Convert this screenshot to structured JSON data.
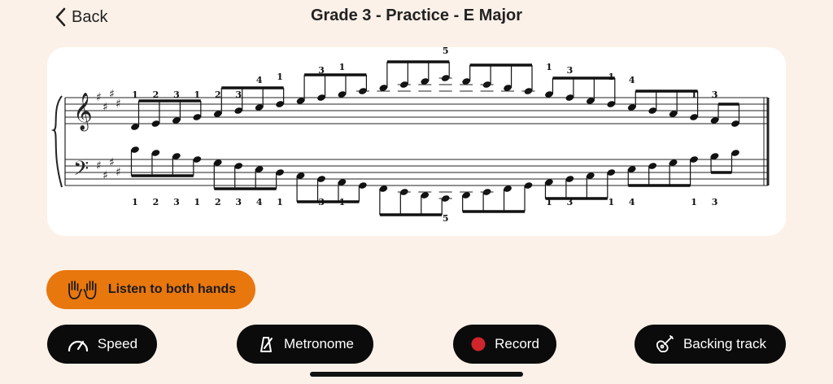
{
  "header": {
    "back_label": "Back",
    "title": "Grade 3 - Practice - E Major"
  },
  "score": {
    "clefs": [
      "treble",
      "bass"
    ],
    "key_signature": "E major (4 sharps)",
    "treble_fingering": [
      "1",
      "2",
      "3",
      "1",
      "2",
      "3",
      "4",
      "1",
      "3",
      "1",
      "5",
      "1",
      "3",
      "1",
      "4",
      "1",
      "3"
    ],
    "bass_fingering": [
      "1",
      "2",
      "3",
      "1",
      "2",
      "3",
      "4",
      "1",
      "3",
      "1",
      "5",
      "1",
      "3",
      "1",
      "4",
      "1",
      "3"
    ]
  },
  "listen_button": {
    "label": "Listen to both hands",
    "icon": "two-hands-icon"
  },
  "controls": {
    "speed": {
      "label": "Speed",
      "icon": "speedometer-icon"
    },
    "metronome": {
      "label": "Metronome",
      "icon": "metronome-icon"
    },
    "record": {
      "label": "Record",
      "icon": "record-dot-icon"
    },
    "backing": {
      "label": "Backing track",
      "icon": "guitar-icon"
    }
  },
  "colors": {
    "background": "#fcf1e8",
    "accent": "#e8770e",
    "record": "#d0252a",
    "dark": "#0b0b0b"
  }
}
